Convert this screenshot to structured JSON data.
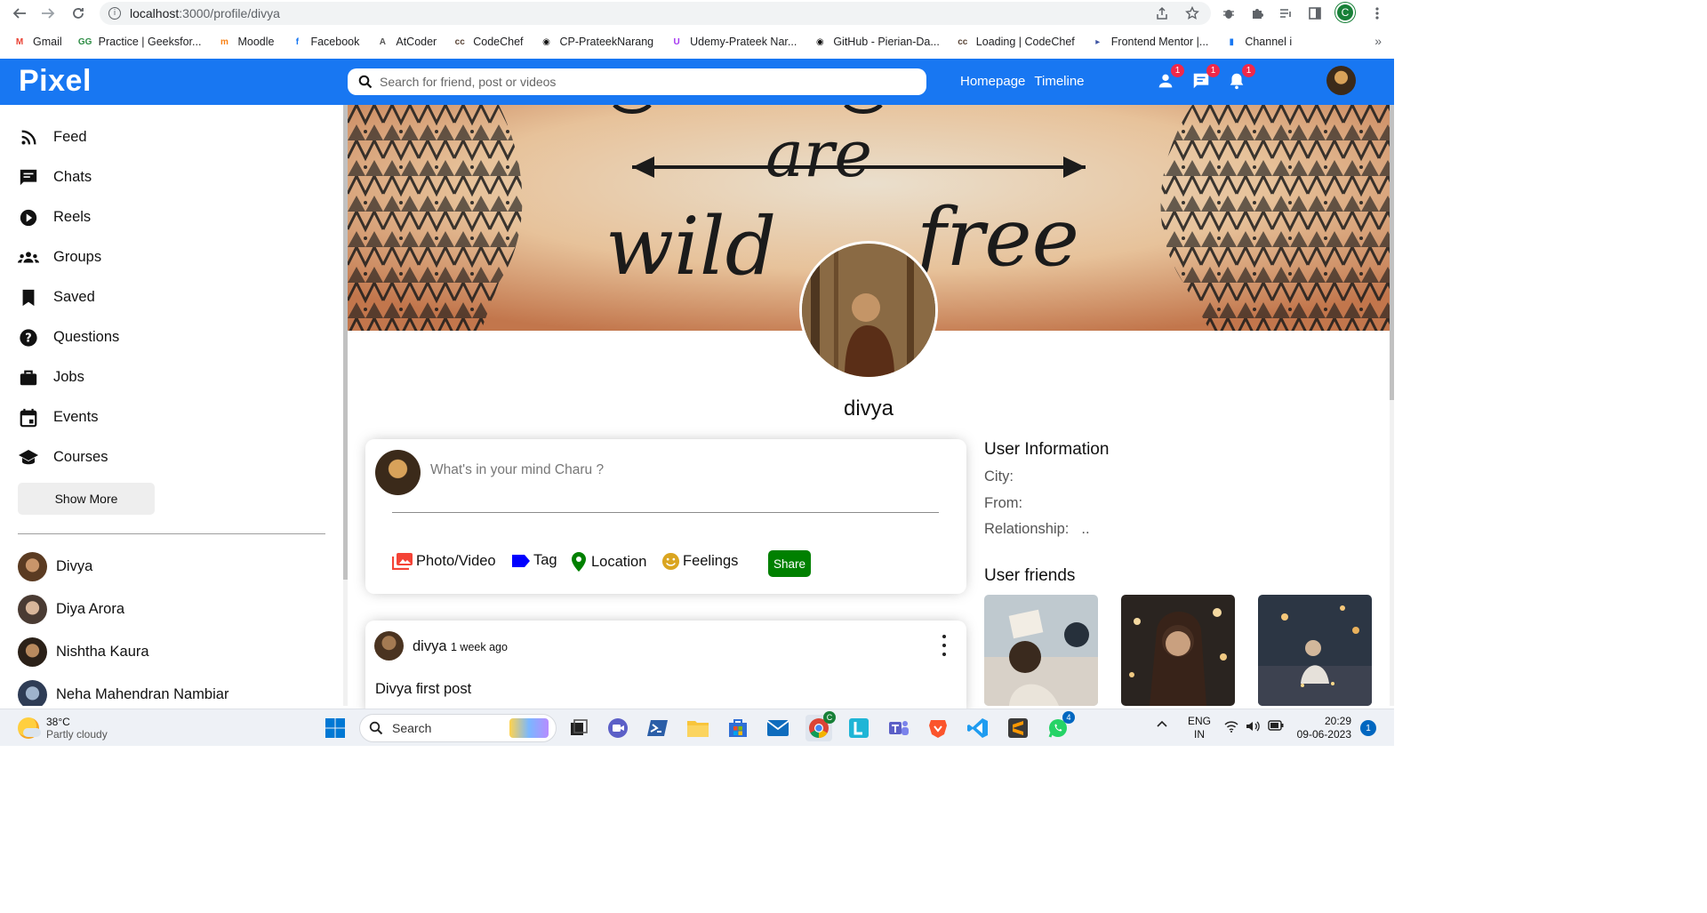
{
  "browser": {
    "url_host": "localhost",
    "url_path": ":3000/profile/divya",
    "profile_initial": "C",
    "bookmarks": [
      {
        "label": "Gmail",
        "icon": "gmail-icon",
        "color": "#ea4335"
      },
      {
        "label": "Practice | Geeksfor...",
        "icon": "geeksforgeeks-icon",
        "color": "#2f8d46"
      },
      {
        "label": "Moodle",
        "icon": "moodle-icon",
        "color": "#f98012"
      },
      {
        "label": "Facebook",
        "icon": "facebook-icon",
        "color": "#1877f2"
      },
      {
        "label": "AtCoder",
        "icon": "atcoder-icon",
        "color": "#555555"
      },
      {
        "label": "CodeChef",
        "icon": "codechef-icon",
        "color": "#5b4638"
      },
      {
        "label": "CP-PrateekNarang",
        "icon": "github-icon",
        "color": "#111111"
      },
      {
        "label": "Udemy-Prateek Nar...",
        "icon": "udemy-icon",
        "color": "#a435f0"
      },
      {
        "label": "GitHub - Pierian-Da...",
        "icon": "github-icon",
        "color": "#111111"
      },
      {
        "label": "Loading | CodeChef",
        "icon": "codechef-icon",
        "color": "#5b4638"
      },
      {
        "label": "Frontend Mentor |...",
        "icon": "frontend-mentor-icon",
        "color": "#3e54a3"
      },
      {
        "label": "Channel i",
        "icon": "channel-icon",
        "color": "#1877f2"
      }
    ]
  },
  "topbar": {
    "logo": "Pixel",
    "search_placeholder": "Search for friend, post or videos",
    "links": [
      "Homepage",
      "Timeline"
    ],
    "badges": {
      "friends": "1",
      "messages": "1",
      "notifications": "1"
    },
    "brand_color": "#1877f2"
  },
  "sidebar": {
    "items": [
      {
        "label": "Feed",
        "icon": "rss-feed-icon"
      },
      {
        "label": "Chats",
        "icon": "chat-icon"
      },
      {
        "label": "Reels",
        "icon": "play-circle-icon"
      },
      {
        "label": "Groups",
        "icon": "groups-icon"
      },
      {
        "label": "Saved",
        "icon": "bookmark-icon"
      },
      {
        "label": "Questions",
        "icon": "help-icon"
      },
      {
        "label": "Jobs",
        "icon": "work-icon"
      },
      {
        "label": "Events",
        "icon": "event-icon"
      },
      {
        "label": "Courses",
        "icon": "school-icon"
      }
    ],
    "show_more": "Show More",
    "friends": [
      "Divya",
      "Diya Arora",
      "Nishtha Kaura",
      "Neha Mahendran Nambiar"
    ]
  },
  "profile": {
    "name": "divya",
    "cover_text": [
      "are",
      "wild",
      "free"
    ]
  },
  "share": {
    "placeholder": "What's in your mind Charu ?",
    "options": [
      {
        "label": "Photo/Video",
        "icon": "photo-library-icon",
        "color": "#f44336"
      },
      {
        "label": "Tag",
        "icon": "label-icon",
        "color": "#0000ff"
      },
      {
        "label": "Location",
        "icon": "room-icon",
        "color": "#008000"
      },
      {
        "label": "Feelings",
        "icon": "emoji-icon",
        "color": "#daa520"
      }
    ],
    "button": "Share",
    "button_color": "#008000"
  },
  "post": {
    "user": "divya",
    "date": "1 week ago",
    "text": "Divya first post"
  },
  "user_info": {
    "title": "User Information",
    "rows": [
      {
        "label": "City:",
        "value": ""
      },
      {
        "label": "From:",
        "value": ""
      },
      {
        "label": "Relationship:",
        "value": ".."
      }
    ],
    "friends_title": "User friends"
  },
  "taskbar": {
    "temperature": "38°C",
    "weather": "Partly cloudy",
    "search": "Search",
    "whatsapp_badge": "4",
    "lang_top": "ENG",
    "lang_bottom": "IN",
    "time": "20:29",
    "date": "09-06-2023",
    "notifications": "1"
  }
}
